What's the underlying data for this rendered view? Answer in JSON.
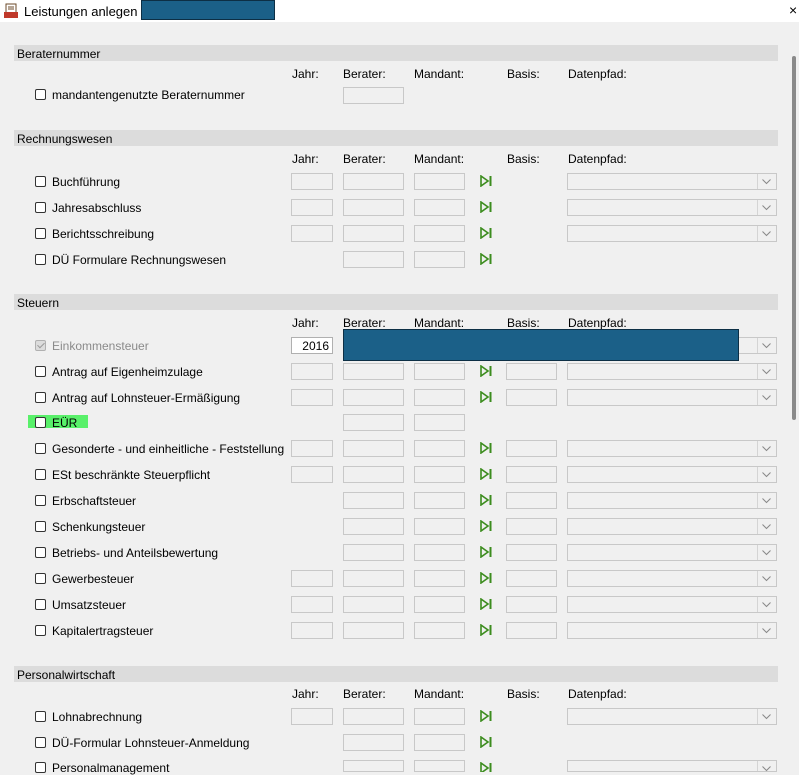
{
  "window": {
    "title": "Leistungen anlegen -",
    "close": "×"
  },
  "columns": {
    "jahr": "Jahr:",
    "berater": "Berater:",
    "mandant": "Mandant:",
    "basis": "Basis:",
    "datenpfad": "Datenpfad:"
  },
  "sections": {
    "beraternummer": {
      "title": "Beraternummer",
      "items": [
        "mandantengenutzte Beraternummer"
      ]
    },
    "rechnungswesen": {
      "title": "Rechnungswesen",
      "items": [
        "Buchführung",
        "Jahresabschluss",
        "Berichtsschreibung",
        "DÜ Formulare Rechnungswesen"
      ]
    },
    "steuern": {
      "title": "Steuern",
      "einkommensteuer_jahr": "2016",
      "items": [
        "Einkommensteuer",
        "Antrag auf Eigenheimzulage",
        "Antrag auf Lohnsteuer-Ermäßigung",
        "EÜR",
        "Gesonderte - und einheitliche - Feststellung",
        "ESt beschränkte Steuerpflicht",
        "Erbschaftsteuer",
        "Schenkungsteuer",
        "Betriebs- und Anteilsbewertung",
        "Gewerbesteuer",
        "Umsatzsteuer",
        "Kapitalertragsteuer"
      ]
    },
    "personalwirtschaft": {
      "title": "Personalwirtschaft",
      "items": [
        "Lohnabrechnung",
        "DÜ-Formular Lohnsteuer-Anmeldung",
        "Personalmanagement"
      ]
    }
  },
  "colors": {
    "redaction": "#1b6088",
    "highlight": "#59f06a",
    "play_icon": "#3c8c1e"
  }
}
